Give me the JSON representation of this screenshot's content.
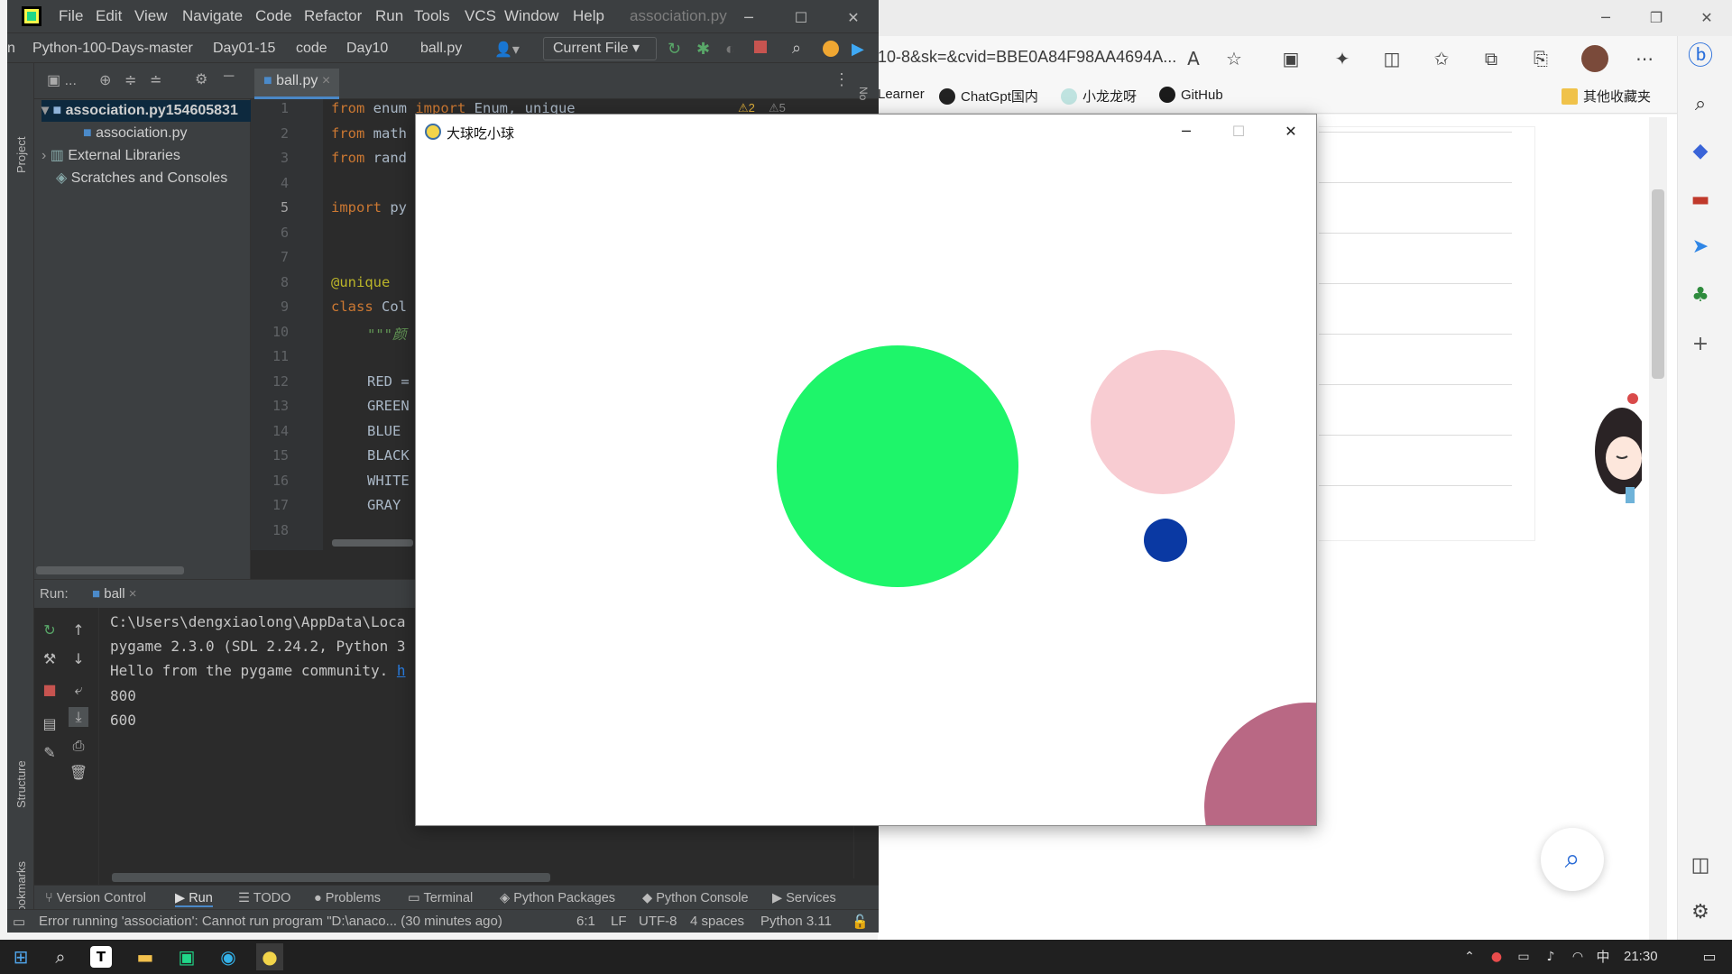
{
  "browser": {
    "address": "10-8&sk=&cvid=BBE0A84F98AA4694A...",
    "favorites": [
      {
        "label": "Learner",
        "icon": "learner-icon"
      },
      {
        "label": "ChatGpt国内",
        "icon": "chatgpt-icon"
      },
      {
        "label": "小龙龙呀",
        "icon": "site-icon"
      },
      {
        "label": "GitHub",
        "icon": "github-icon"
      },
      {
        "label": "其他收藏夹",
        "icon": "folder-icon"
      }
    ]
  },
  "ide": {
    "menu": [
      "File",
      "Edit",
      "View",
      "Navigate",
      "Code",
      "Refactor",
      "Run",
      "Tools",
      "VCS",
      "Window",
      "Help"
    ],
    "window_title": "association.py",
    "breadcrumbs": [
      "n",
      "Python-100-Days-master",
      "Day01-15",
      "code",
      "Day10",
      "ball.py"
    ],
    "run_config": "Current File",
    "project_tree": {
      "root": "association.py154605831",
      "file": "association.py",
      "external": "External Libraries",
      "scratches": "Scratches and Consoles"
    },
    "editor_tab": "ball.py",
    "warnings": {
      "a": "2",
      "b": "5"
    },
    "line_numbers": [
      "1",
      "2",
      "3",
      "4",
      "5",
      "6",
      "7",
      "8",
      "9",
      "10",
      "11",
      "12",
      "13",
      "14",
      "15",
      "16",
      "17",
      "18"
    ],
    "code": {
      "l1_kw": "from",
      "l1_mod": " enum ",
      "l1_kw2": "import",
      "l1_rest": " Enum, unique",
      "l2_kw": "from",
      "l2_mod": " math",
      "l3_kw": "from",
      "l3_mod": " rand",
      "l5_kw": "import",
      "l5_mod": " py",
      "l8": "@unique",
      "l9_kw": "class",
      "l9_rest": " Col",
      "l10": "\"\"\"颜",
      "l12": "RED =",
      "l13": "GREEN",
      "l14": "BLUE",
      "l15": "BLACK",
      "l16": "WHITE",
      "l17": "GRAY"
    },
    "run_label": "Run:",
    "run_tab": "ball",
    "console": [
      "C:\\Users\\dengxiaolong\\AppData\\Loca",
      "pygame 2.3.0 (SDL 2.24.2, Python 3",
      "Hello from the pygame community.",
      "800",
      "600"
    ],
    "console_link": "h",
    "side_labels": {
      "project": "Project",
      "structure": "Structure",
      "bookmarks": "Bookmarks",
      "notifications": "No"
    },
    "tool_tabs": [
      "Version Control",
      "Run",
      "TODO",
      "Problems",
      "Terminal",
      "Python Packages",
      "Python Console",
      "Services"
    ],
    "status": {
      "message": "Error running 'association': Cannot run program \"D:\\anaco... (30 minutes ago)",
      "position": "6:1",
      "line_ending": "LF",
      "encoding": "UTF-8",
      "indent": "4 spaces",
      "interpreter": "Python 3.11"
    }
  },
  "game": {
    "title": "大球吃小球",
    "balls": [
      {
        "name": "green-ball",
        "color": "#1ef56a"
      },
      {
        "name": "pink-ball",
        "color": "#f8ccd2"
      },
      {
        "name": "blue-ball",
        "color": "#0a39a3"
      },
      {
        "name": "mauve-ball",
        "color": "#b96884"
      }
    ]
  },
  "taskbar": {
    "clock": "21:30",
    "ime": "中"
  }
}
